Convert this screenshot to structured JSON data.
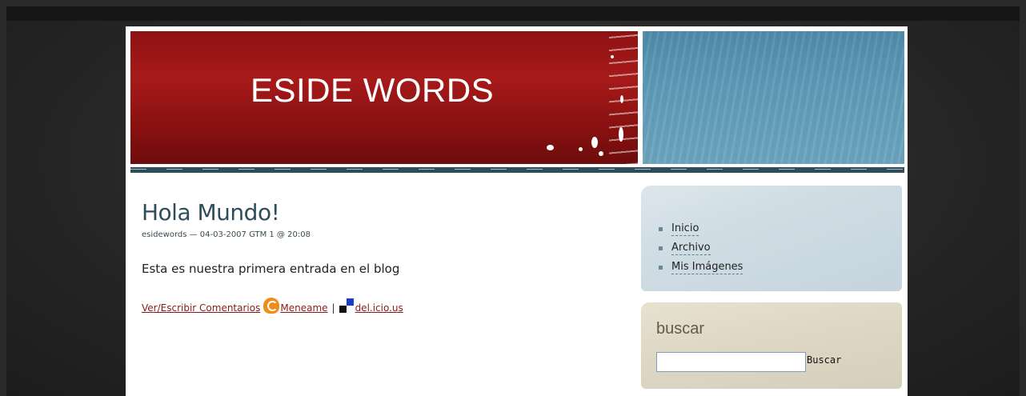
{
  "header": {
    "title": "ESIDE WORDS"
  },
  "post": {
    "title": "Hola Mundo!",
    "meta": "esidewords — 04-03-2007 GTM 1 @ 20:08",
    "body": "Esta es nuestra primera entrada en el blog",
    "links": {
      "comments": "Ver/Escribir Comentarios",
      "meneame": "Meneame",
      "separator": "|",
      "delicious": "del.icio.us"
    }
  },
  "sidebar": {
    "nav": [
      {
        "label": "Inicio"
      },
      {
        "label": "Archivo"
      },
      {
        "label": "Mis Imágenes"
      }
    ],
    "search": {
      "title": "buscar",
      "input_value": "",
      "button_label": "Buscar"
    }
  },
  "colors": {
    "brand_red": "#a71a1a",
    "brand_blue": "#5e9cb9",
    "title_text": "#2f4c5a",
    "link_red": "#8a1a1a"
  }
}
